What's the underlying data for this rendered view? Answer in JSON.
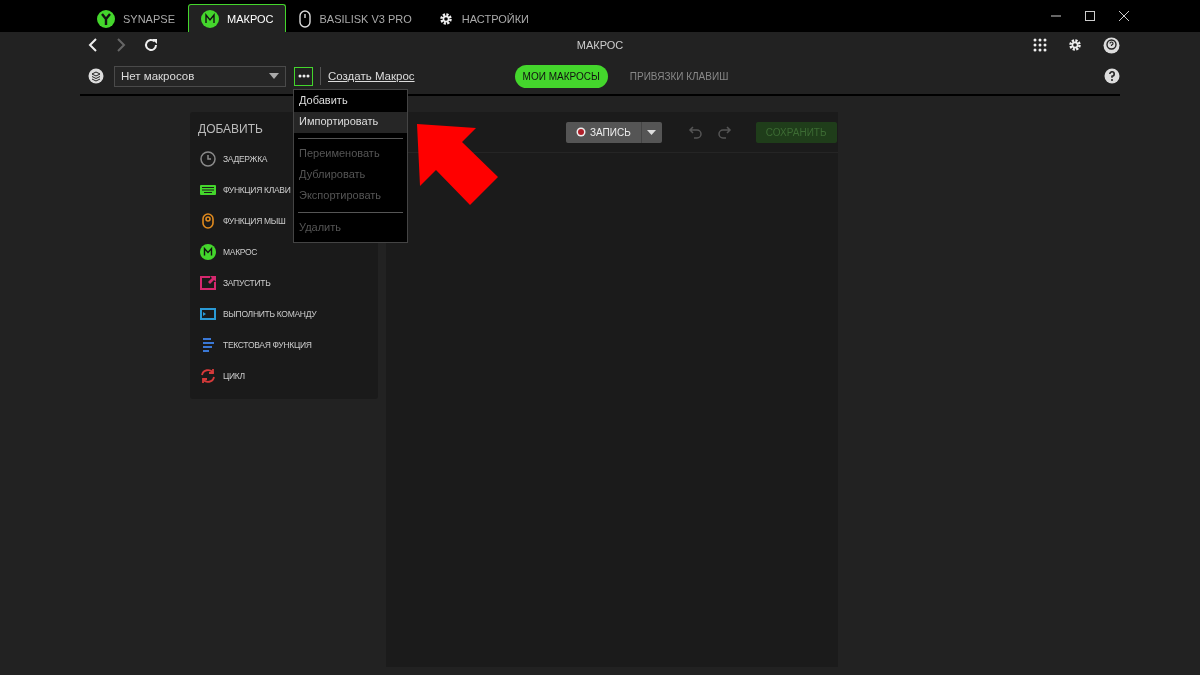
{
  "tabs": [
    {
      "label": "SYNAPSE",
      "kind": "synapse",
      "selected": false
    },
    {
      "label": "МАКРОС",
      "kind": "macro",
      "selected": true
    },
    {
      "label": "BASILISK V3 PRO",
      "kind": "mouse",
      "selected": false
    },
    {
      "label": "НАСТРОЙКИ",
      "kind": "settings",
      "selected": false
    }
  ],
  "page_title": "МАКРОС",
  "macro_select": {
    "value": "Нет макросов"
  },
  "create_link": "Создать Макрос",
  "subtabs": [
    {
      "label": "МОИ МАКРОСЫ",
      "selected": true
    },
    {
      "label": "ПРИВЯЗКИ КЛАВИШ",
      "selected": false
    }
  ],
  "menu": [
    {
      "kind": "item",
      "label": "Добавить",
      "selected": false,
      "disabled": false
    },
    {
      "kind": "item",
      "label": "Импортировать",
      "selected": true,
      "disabled": false
    },
    {
      "kind": "separator"
    },
    {
      "kind": "item",
      "label": "Переименовать",
      "selected": false,
      "disabled": true
    },
    {
      "kind": "item",
      "label": "Дублировать",
      "selected": false,
      "disabled": true
    },
    {
      "kind": "item",
      "label": "Экспортировать",
      "selected": false,
      "disabled": true
    },
    {
      "kind": "separator"
    },
    {
      "kind": "item",
      "label": "Удалить",
      "selected": false,
      "disabled": true
    }
  ],
  "add_panel": {
    "title": "ДОБАВИТЬ",
    "items": [
      {
        "kind": "delay",
        "label": "ЗАДЕРЖКА",
        "color": "#8a8a8a"
      },
      {
        "kind": "keyboard",
        "label": "ФУНКЦИЯ КЛАВИ",
        "color": "#44d62c"
      },
      {
        "kind": "mouse",
        "label": "ФУНКЦИЯ МЫШ",
        "color": "#e08a1e"
      },
      {
        "kind": "macro",
        "label": "МАКРОС",
        "color": "#44d62c"
      },
      {
        "kind": "launch",
        "label": "ЗАПУСТИТЬ",
        "color": "#d6286e"
      },
      {
        "kind": "command",
        "label": "ВЫПОЛНИТЬ КОМАНДУ",
        "color": "#2a9ad6"
      },
      {
        "kind": "text",
        "label": "ТЕКСТОВАЯ ФУНКЦИЯ",
        "color": "#3a78d6"
      },
      {
        "kind": "loop",
        "label": "ЦИКЛ",
        "color": "#d63a3a"
      }
    ]
  },
  "editor": {
    "record": "ЗАПИСЬ",
    "save": "СОХРАНИТЬ",
    "save_disabled": true
  }
}
